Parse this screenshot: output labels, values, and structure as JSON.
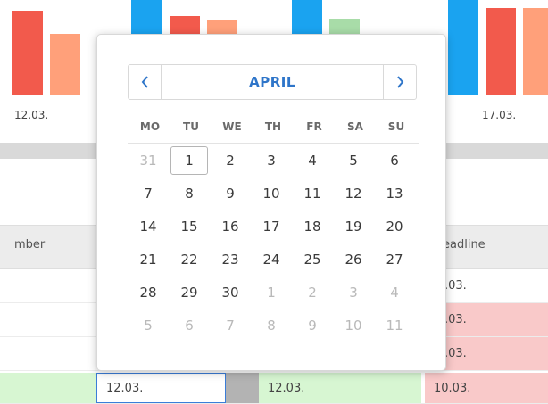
{
  "chart": {
    "label_left": "12.03.",
    "label_right": "17.03."
  },
  "table": {
    "header_left": "mber",
    "header_right": "eadline",
    "rows": [
      {
        "right": ".03."
      },
      {
        "right": ".03."
      },
      {
        "right": ".03."
      }
    ],
    "last_row": {
      "cell2": "12.03.",
      "cell3": "12.03.",
      "cell4": "10.03."
    }
  },
  "datepicker": {
    "month": "APRIL",
    "prev_icon": "chevron-left-icon",
    "next_icon": "chevron-right-icon",
    "weekdays": [
      "MO",
      "TU",
      "WE",
      "TH",
      "FR",
      "SA",
      "SU"
    ],
    "weeks": [
      [
        {
          "d": "31",
          "other": true
        },
        {
          "d": "1",
          "today": true
        },
        {
          "d": "2"
        },
        {
          "d": "3"
        },
        {
          "d": "4"
        },
        {
          "d": "5"
        },
        {
          "d": "6"
        }
      ],
      [
        {
          "d": "7"
        },
        {
          "d": "8"
        },
        {
          "d": "9"
        },
        {
          "d": "10"
        },
        {
          "d": "11"
        },
        {
          "d": "12"
        },
        {
          "d": "13"
        }
      ],
      [
        {
          "d": "14"
        },
        {
          "d": "15"
        },
        {
          "d": "16"
        },
        {
          "d": "17"
        },
        {
          "d": "18"
        },
        {
          "d": "19"
        },
        {
          "d": "20"
        }
      ],
      [
        {
          "d": "21"
        },
        {
          "d": "22"
        },
        {
          "d": "23"
        },
        {
          "d": "24"
        },
        {
          "d": "25"
        },
        {
          "d": "26"
        },
        {
          "d": "27"
        }
      ],
      [
        {
          "d": "28"
        },
        {
          "d": "29"
        },
        {
          "d": "30"
        },
        {
          "d": "1",
          "other": true
        },
        {
          "d": "2",
          "other": true
        },
        {
          "d": "3",
          "other": true
        },
        {
          "d": "4",
          "other": true
        }
      ],
      [
        {
          "d": "5",
          "other": true
        },
        {
          "d": "6",
          "other": true
        },
        {
          "d": "7",
          "other": true
        },
        {
          "d": "8",
          "other": true
        },
        {
          "d": "9",
          "other": true
        },
        {
          "d": "10",
          "other": true
        },
        {
          "d": "11",
          "other": true
        }
      ]
    ]
  },
  "colors": {
    "accent": "#2e75c9",
    "bar_red": "#f25a4c",
    "bar_orange": "#ffa07a",
    "bar_blue": "#1aa3f0",
    "bar_green": "#a8dca8",
    "row_red": "#f9c9c9",
    "row_green": "#d7f6d2"
  }
}
